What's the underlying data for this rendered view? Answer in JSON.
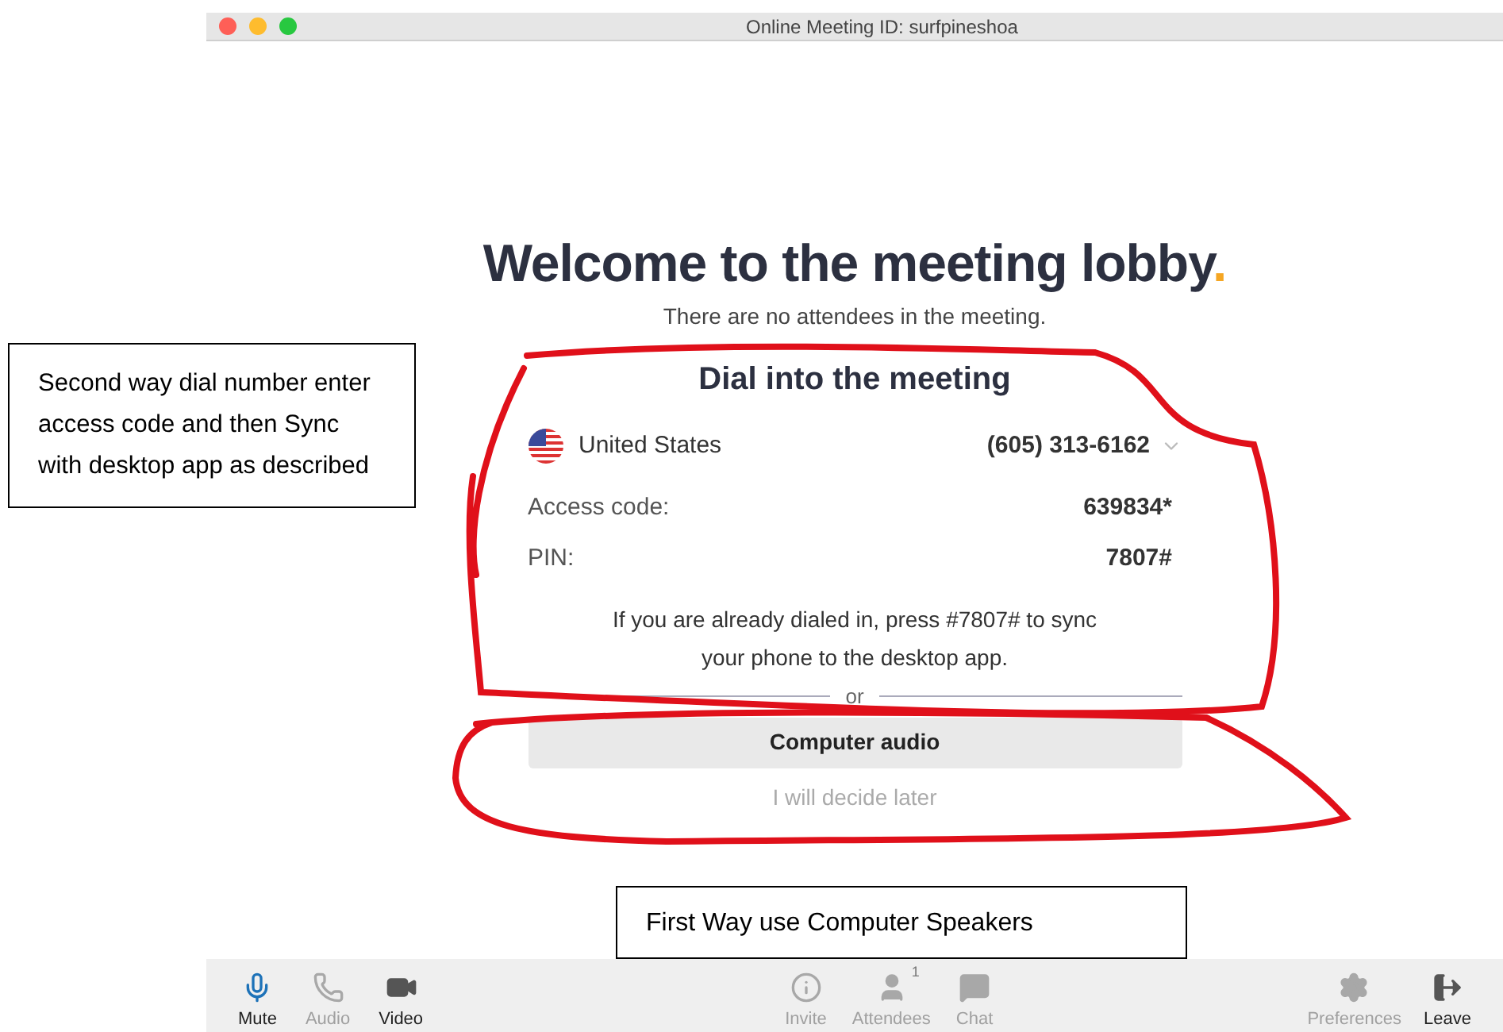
{
  "window": {
    "title": "Online Meeting ID: surfpineshoa",
    "controls": [
      {
        "color": "#fe5f57"
      },
      {
        "color": "#febc2e"
      },
      {
        "color": "#28c840"
      }
    ]
  },
  "lobby": {
    "heading": "Welcome to the meeting lobby",
    "heading_dot": ".",
    "subtitle": "There are no attendees in the meeting."
  },
  "dial_in": {
    "title": "Dial into the meeting",
    "country": "United States",
    "phone": "(605) 313-6162",
    "fields": [
      {
        "label": "Access code:",
        "value": "639834*"
      },
      {
        "label": "PIN:",
        "value": "7807#"
      }
    ],
    "note": "If you are already dialed in, press #7807# to sync your phone to the desktop app."
  },
  "divider": "or",
  "computer_audio_button": "Computer audio",
  "decide_later_link": "I will decide later",
  "annotations": [
    {
      "kind": "left",
      "text": "Second way dial number enter access code and then Sync with desktop app as described"
    },
    {
      "kind": "bottom",
      "text": "First Way use Computer Speakers"
    }
  ],
  "toolbar": [
    {
      "kind": "mic",
      "label": "Mute",
      "active": true,
      "disabled": false
    },
    {
      "kind": "phone",
      "label": "Audio",
      "active": false,
      "disabled": true
    },
    {
      "kind": "video",
      "label": "Video",
      "active": false,
      "disabled": false
    },
    {
      "kind": "info",
      "label": "Invite",
      "active": false,
      "disabled": true
    },
    {
      "kind": "user",
      "label": "Attendees",
      "active": false,
      "disabled": true,
      "badge": "1"
    },
    {
      "kind": "chat",
      "label": "Chat",
      "active": false,
      "disabled": true
    },
    {
      "kind": "gear",
      "label": "Preferences",
      "active": false,
      "disabled": true
    },
    {
      "kind": "leave",
      "label": "Leave",
      "active": false,
      "disabled": false
    }
  ]
}
